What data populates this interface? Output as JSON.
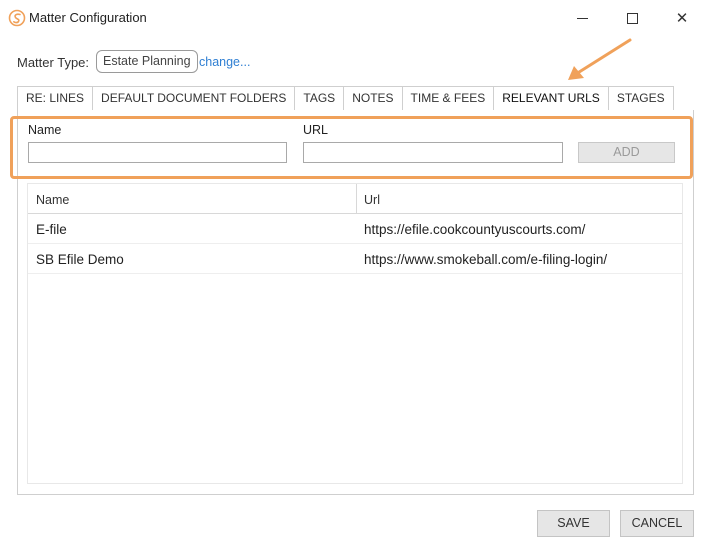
{
  "window": {
    "title": "Matter Configuration",
    "logo_icon": "smokeball-logo-icon",
    "accent_color": "#f0a15a",
    "minimize_icon": "minimize-icon",
    "maximize_icon": "maximize-icon",
    "close_symbol": "✕"
  },
  "matter_type": {
    "label": "Matter Type:",
    "value": "Estate Planning",
    "change_link": "change..."
  },
  "tabs": [
    {
      "label": "RE: LINES",
      "active": false
    },
    {
      "label": "DEFAULT DOCUMENT FOLDERS",
      "active": false
    },
    {
      "label": "TAGS",
      "active": false
    },
    {
      "label": "NOTES",
      "active": false
    },
    {
      "label": "TIME & FEES",
      "active": false
    },
    {
      "label": "RELEVANT URLS",
      "active": true
    },
    {
      "label": "STAGES",
      "active": false
    }
  ],
  "form": {
    "name_label": "Name",
    "name_value": "",
    "url_label": "URL",
    "url_value": "",
    "add_button": "ADD"
  },
  "grid": {
    "columns": [
      "Name",
      "Url"
    ],
    "rows": [
      {
        "name": "E-file",
        "url": "https://efile.cookcountyuscourts.com/"
      },
      {
        "name": "SB Efile Demo",
        "url": "https://www.smokeball.com/e-filing-login/"
      }
    ]
  },
  "footer": {
    "save_label": "SAVE",
    "cancel_label": "CANCEL"
  }
}
